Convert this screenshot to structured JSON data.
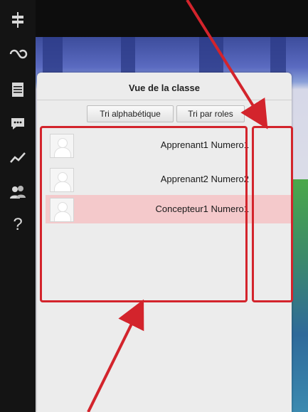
{
  "rail": {
    "icons": [
      "signpost-icon",
      "loop-icon",
      "calendar-icon",
      "chat-icon",
      "chart-icon",
      "users-icon",
      "help-icon"
    ],
    "help_glyph": "?"
  },
  "panel": {
    "title": "Vue de la classe",
    "sort_alpha_label": "Tri alphabétique",
    "sort_roles_label": "Tri par roles",
    "rows": [
      {
        "name": "Apprenant1 Numero1",
        "highlighted": false
      },
      {
        "name": "Apprenant2 Numero2",
        "highlighted": false
      },
      {
        "name": "Concepteur1 Numero1",
        "highlighted": true
      }
    ]
  },
  "colors": {
    "annotation_red": "#d3242c",
    "highlight_row": "#f4c9cb",
    "rail_bg": "#141414"
  }
}
